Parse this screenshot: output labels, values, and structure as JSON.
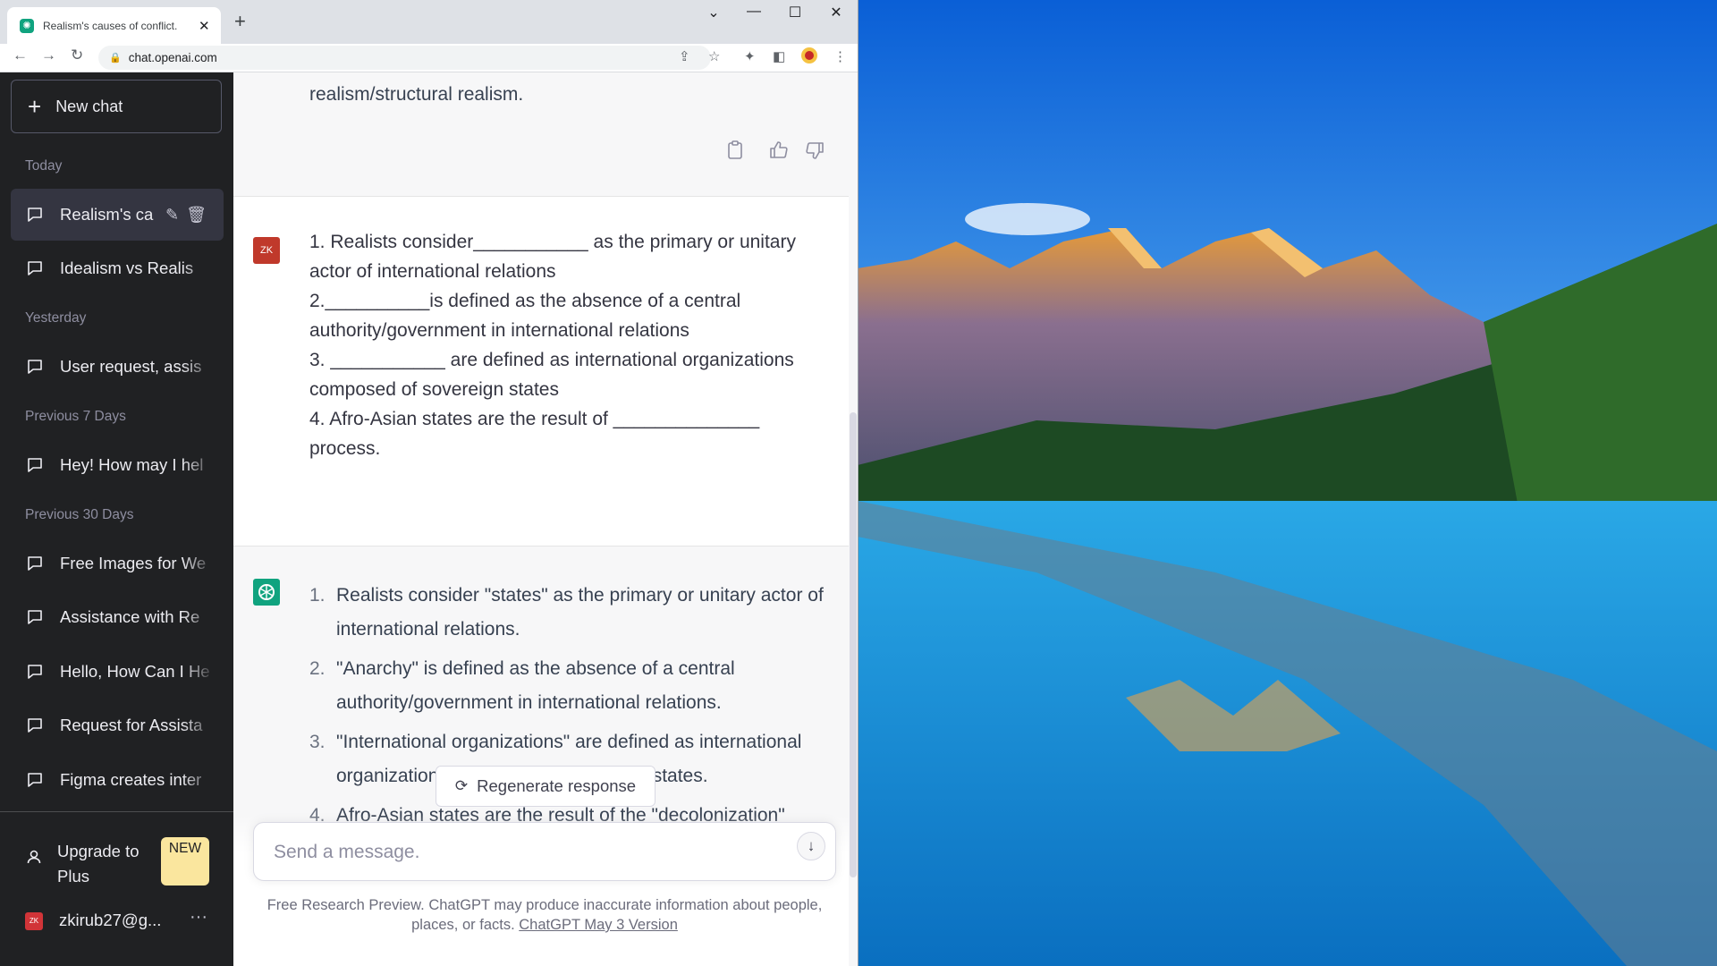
{
  "browser": {
    "tab_title": "Realism's causes of conflict.",
    "url": "chat.openai.com",
    "new_tab_symbol": "+",
    "window_controls": [
      "⌄",
      "—",
      "☐",
      "✕"
    ]
  },
  "sidebar": {
    "new_chat_label": "New chat",
    "sections": [
      {
        "heading": "Today",
        "items": [
          "Realism's ca",
          "Idealism vs Realis"
        ]
      },
      {
        "heading": "Yesterday",
        "items": [
          "User request, assis"
        ]
      },
      {
        "heading": "Previous 7 Days",
        "items": [
          "Hey! How may I hel"
        ]
      },
      {
        "heading": "Previous 30 Days",
        "items": [
          "Free Images for We",
          "Assistance with Re",
          "Hello, How Can I He",
          "Request for Assista",
          "Figma creates inter"
        ]
      }
    ],
    "upgrade_label": "Upgrade to Plus",
    "upgrade_badge": "NEW",
    "user_email": "zkirub27@g...",
    "user_initials": "ZK",
    "more_symbol": "···"
  },
  "conversation": {
    "prev_tail": "realism/structural realism.",
    "user_initials": "ZK",
    "user_message": [
      "1. Realists consider___________ as the primary or unitary",
      "actor of international relations",
      "2.__________is defined as the absence of a central",
      "authority/government in international relations",
      "3. ___________ are defined as international organizations",
      "composed of sovereign states",
      "4. Afro-Asian states are the result of ______________",
      "process."
    ],
    "answers": [
      {
        "num": "1.",
        "text": "Realists consider \"states\" as the primary or unitary actor of international relations."
      },
      {
        "num": "2.",
        "text": "\"Anarchy\" is defined as the absence of a central authority/government in international relations."
      },
      {
        "num": "3.",
        "text": "\"International organizations\" are defined as international organizations composed of sovereign states."
      },
      {
        "num": "4.",
        "text": "Afro-Asian states are the result of the \"decolonization\" process."
      }
    ]
  },
  "composer": {
    "regenerate_label": "Regenerate response",
    "placeholder": "Send a message.",
    "disclaimer": "Free Research Preview. ChatGPT may produce inaccurate information about people, places, or facts.",
    "version_link": "ChatGPT May 3 Version"
  },
  "colors": {
    "sidebar_bg": "#202123",
    "active_item_bg": "#343541",
    "assistant_avatar": "#10a37f",
    "user_avatar": "#c0392b",
    "badge": "#fae69e"
  }
}
